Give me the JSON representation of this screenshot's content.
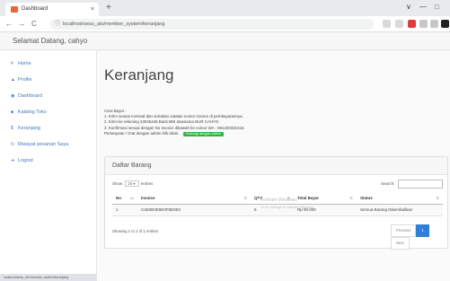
{
  "browser": {
    "tab_title": "Dashboard",
    "tab_close": "×",
    "new_tab": "+",
    "url": "localhost/sesu_ato/member_system/keranjang",
    "nav": {
      "back": "←",
      "forward": "→",
      "reload": "C"
    },
    "window": {
      "chevron": "∨",
      "minimize": "—",
      "maximize": "□"
    }
  },
  "header": {
    "greeting": "Selamat Datang, cahyo"
  },
  "sidebar": {
    "items": [
      {
        "icon": "#",
        "label": "Home"
      },
      {
        "icon": "▲",
        "label": "Profile"
      },
      {
        "icon": "◉",
        "label": "Dashboard"
      },
      {
        "icon": "■",
        "label": "Katalog Toko"
      },
      {
        "icon": "$",
        "label": "Keranjang"
      },
      {
        "icon": "↻",
        "label": "Riwayat pesanan Saya"
      },
      {
        "icon": "➜",
        "label": "Logout"
      }
    ],
    "status_url": "localhost/sesu_ato/member_system/keranjang"
  },
  "main": {
    "title": "Keranjang",
    "instructions": {
      "heading": "Cara Bayar :",
      "steps": [
        "1. Kirim sesuai nominal dan sertakan catatan nomor invoice di pembayarannya.",
        "2. Kirim ke rekening 23025445 Bank BNI atasnama NUR CAHYO",
        "3. Konfirmasi sesuai dengan No Invoice dibawah ke nomor WA : 081230331016.",
        "Pertanyaan / chat dengan admin klik disini."
      ],
      "wa_button": "Hubungi dengan admin"
    },
    "panel": {
      "title": "Daftar Barang",
      "show_label": "Show",
      "show_value": "10",
      "entries_label": "entries",
      "search_label": "Search:",
      "columns": [
        "No",
        "Invoice",
        "QTY",
        "Total Bayar",
        "Status"
      ],
      "rows": [
        {
          "no": "1",
          "invoice": "C4E0E0E5E0F5E0E0",
          "qty": "5",
          "total": "Rp 90.000",
          "status": "Semua Barang Dikembalikan"
        }
      ],
      "info": "Showing 1 to 1 of 1 entries",
      "pager": {
        "prev": "Previous",
        "page": "1",
        "next": "Next"
      }
    }
  },
  "watermark": {
    "title": "Activate Windows",
    "subtitle": "Go to Settings to activate Windows."
  },
  "colors": {
    "link": "#3d7bbf",
    "wa_button": "#2fb344",
    "pager_active": "#2f7ed8"
  }
}
